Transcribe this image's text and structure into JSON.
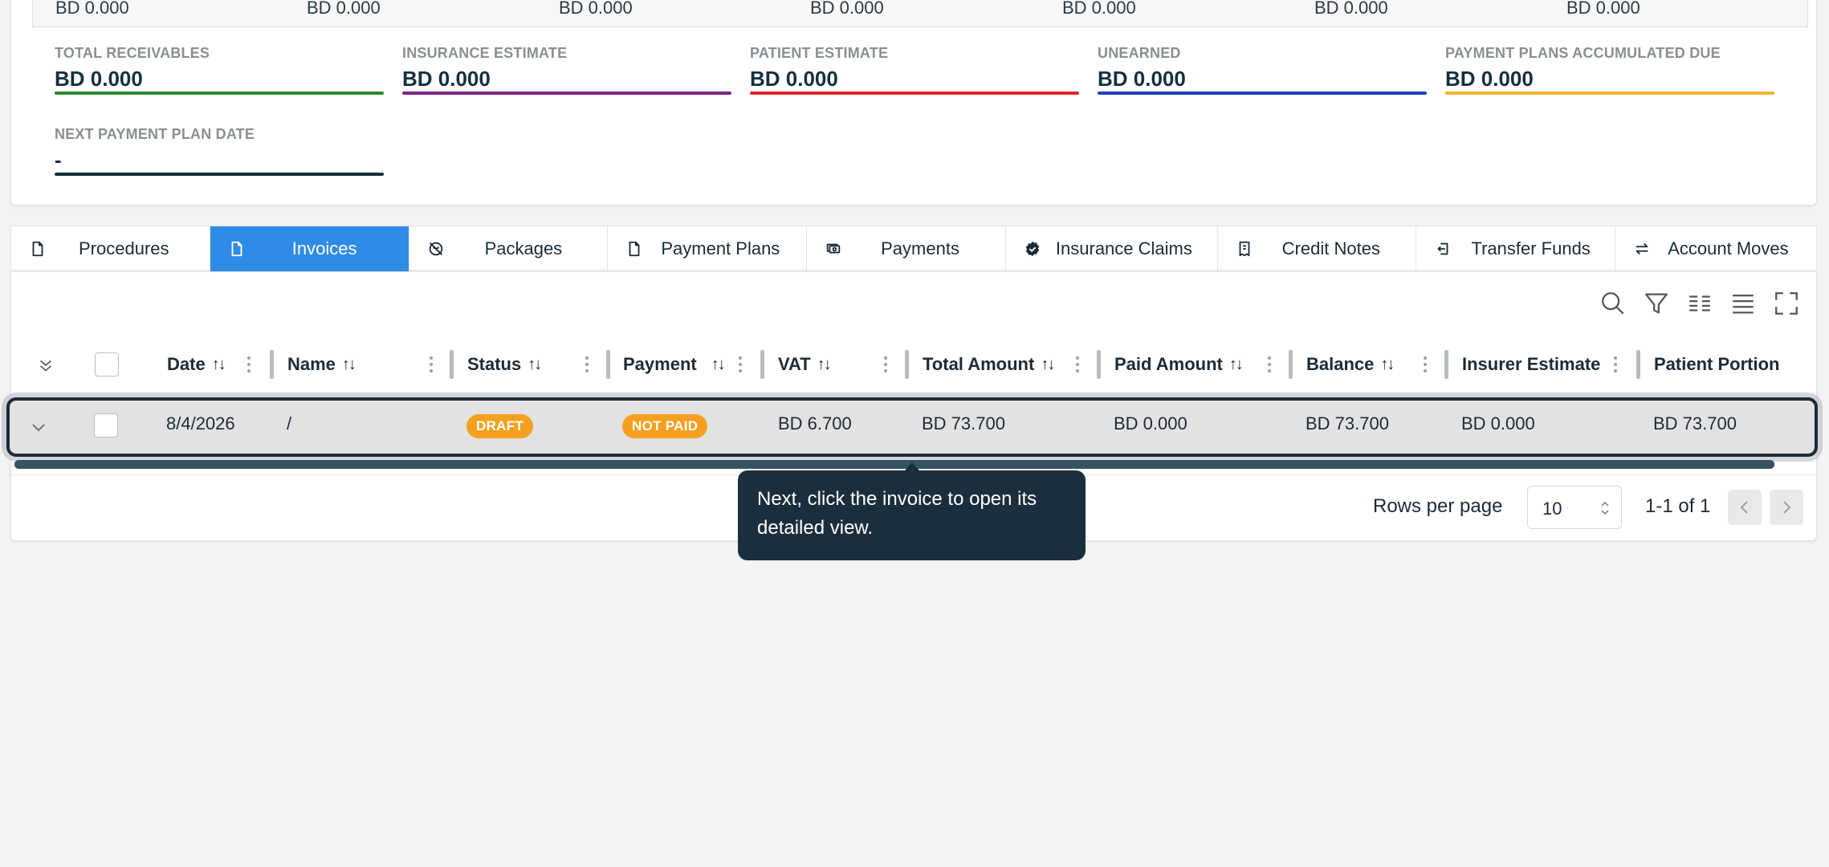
{
  "top_strip_values": [
    "BD 0.000",
    "BD 0.000",
    "BD 0.000",
    "BD 0.000",
    "BD 0.000",
    "BD 0.000",
    "BD 0.000"
  ],
  "metrics": [
    {
      "label": "TOTAL RECEIVABLES",
      "value": "BD 0.000",
      "color": "#2b8a2b"
    },
    {
      "label": "INSURANCE ESTIMATE",
      "value": "BD 0.000",
      "color": "#7b2585"
    },
    {
      "label": "PATIENT ESTIMATE",
      "value": "BD 0.000",
      "color": "#e3262b"
    },
    {
      "label": "UNEARNED",
      "value": "BD 0.000",
      "color": "#2240c4"
    },
    {
      "label": "PAYMENT PLANS ACCUMULATED DUE",
      "value": "BD 0.000",
      "color": "#f2b233"
    },
    {
      "label": "NEXT PAYMENT PLAN DATE",
      "value": "-",
      "color": "#12303f"
    }
  ],
  "tabs": [
    {
      "label": "Procedures",
      "icon": "file-icon",
      "active": false
    },
    {
      "label": "Invoices",
      "icon": "file-icon",
      "active": true
    },
    {
      "label": "Packages",
      "icon": "package-off-icon",
      "active": false
    },
    {
      "label": "Payment Plans",
      "icon": "file-icon",
      "active": false
    },
    {
      "label": "Payments",
      "icon": "cash-icon",
      "active": false
    },
    {
      "label": "Insurance Claims",
      "icon": "badge-check-icon",
      "active": false
    },
    {
      "label": "Credit Notes",
      "icon": "receipt-icon",
      "active": false
    },
    {
      "label": "Transfer Funds",
      "icon": "transfer-icon",
      "active": false
    },
    {
      "label": "Account Moves",
      "icon": "arrows-exchange-icon",
      "active": false
    }
  ],
  "toolbar_icons": [
    "search-icon",
    "filter-icon",
    "columns-icon",
    "density-icon",
    "fullscreen-icon"
  ],
  "columns": [
    "Date",
    "Name",
    "Status",
    "Payment",
    "VAT",
    "Total Amount",
    "Paid Amount",
    "Balance",
    "Insurer Estimate",
    "Patient Portion"
  ],
  "row": {
    "date": "8/4/2026",
    "name": "/",
    "status": "DRAFT",
    "payment": "NOT PAID",
    "vat": "BD 6.700",
    "total_amount": "BD 73.700",
    "paid_amount": "BD 0.000",
    "balance": "BD 73.700",
    "insurer_estimate": "BD 0.000",
    "patient_portion": "BD 73.700"
  },
  "pagination": {
    "rows_per_page_label": "Rows per page",
    "rows_per_page_value": "10",
    "range": "1-1 of 1"
  },
  "tooltip": {
    "text": "Next, click the invoice to open its detailed view."
  },
  "colors": {
    "accent": "#2f8ce6",
    "badge": "#f5a01f",
    "tooltip_bg": "#1b2e3d"
  }
}
